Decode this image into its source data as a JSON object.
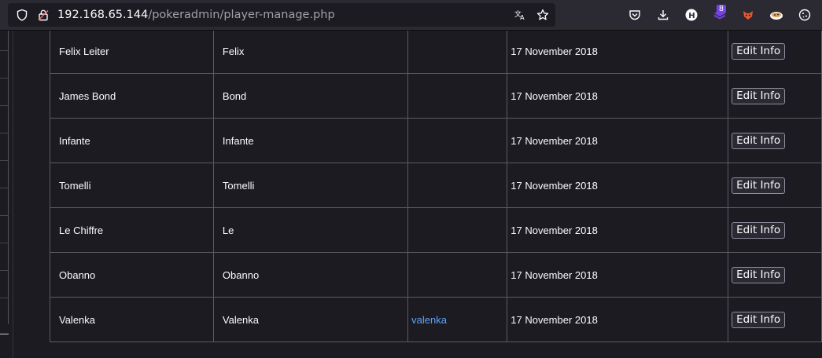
{
  "browser": {
    "url_host": "192.168.65.144",
    "url_path": "/pokeradmin/player-manage.php",
    "extension_badge": "8"
  },
  "table": {
    "button_label": "Edit Info",
    "rows": [
      {
        "name": "Felix Leiter",
        "nickname": "Felix",
        "link": "",
        "date": "17 November 2018"
      },
      {
        "name": "James Bond",
        "nickname": "Bond",
        "link": "",
        "date": "17 November 2018"
      },
      {
        "name": "Infante",
        "nickname": "Infante",
        "link": "",
        "date": "17 November 2018"
      },
      {
        "name": "Tomelli",
        "nickname": "Tomelli",
        "link": "",
        "date": "17 November 2018"
      },
      {
        "name": "Le Chiffre",
        "nickname": "Le",
        "link": "",
        "date": "17 November 2018"
      },
      {
        "name": "Obanno",
        "nickname": "Obanno",
        "link": "",
        "date": "17 November 2018"
      },
      {
        "name": "Valenka",
        "nickname": "Valenka",
        "link": "valenka",
        "date": "17 November 2018"
      }
    ]
  }
}
